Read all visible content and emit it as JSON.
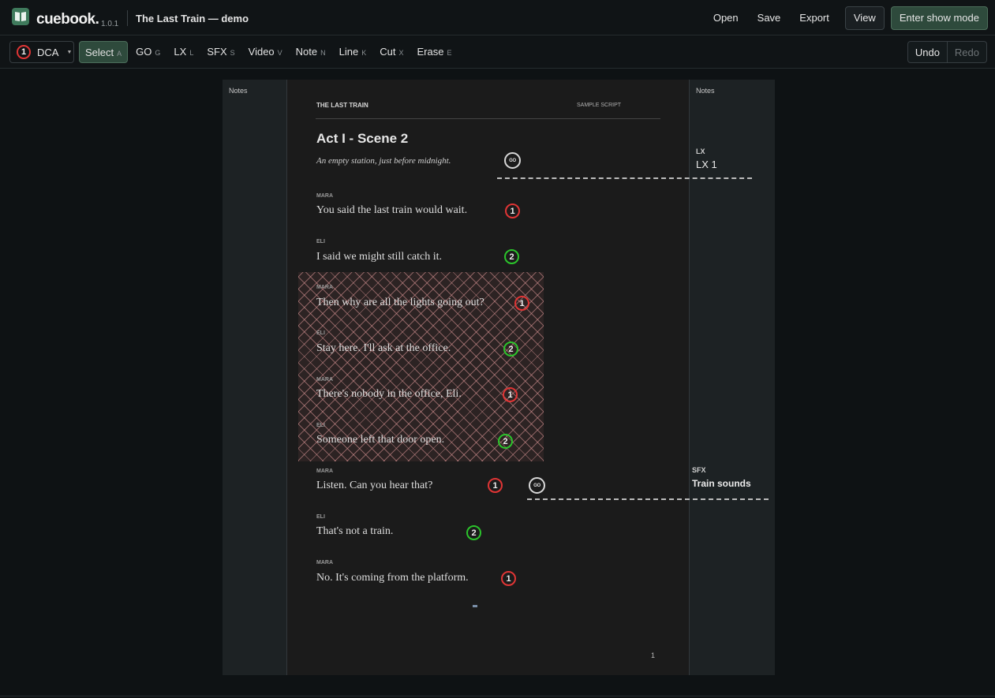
{
  "app": {
    "name": "cuebook.",
    "version": "1.0.1",
    "document_title": "The Last Train — demo"
  },
  "top_actions": {
    "open": "Open",
    "save": "Save",
    "export": "Export",
    "view": "View",
    "show_mode": "Enter show mode"
  },
  "toolbar": {
    "actor": {
      "number": "1",
      "label": "DCA",
      "color": "#e03535"
    },
    "tools": [
      {
        "label": "Select",
        "key": "A"
      },
      {
        "label": "GO",
        "key": "G"
      },
      {
        "label": "LX",
        "key": "L"
      },
      {
        "label": "SFX",
        "key": "S"
      },
      {
        "label": "Video",
        "key": "V"
      },
      {
        "label": "Note",
        "key": "N"
      },
      {
        "label": "Line",
        "key": "K"
      },
      {
        "label": "Cut",
        "key": "X"
      },
      {
        "label": "Erase",
        "key": "E"
      }
    ],
    "undo": "Undo",
    "redo": "Redo"
  },
  "page": {
    "notes_left": "Notes",
    "notes_right": "Notes",
    "header_title": "THE LAST TRAIN",
    "header_sub": "SAMPLE SCRIPT",
    "scene_title": "Act I - Scene 2",
    "scene_desc": "An empty station, just before midnight.",
    "go_marker": "GO",
    "lines": [
      {
        "speaker": "MARA",
        "text": "You said the last train would wait.",
        "cue": "1"
      },
      {
        "speaker": "ELI",
        "text": "I said we might still catch it.",
        "cue": "2"
      },
      {
        "speaker": "MARA",
        "text": "Then why are all the lights going out?",
        "cue": "1"
      },
      {
        "speaker": "ELI",
        "text": "Stay here. I'll ask at the office.",
        "cue": "2"
      },
      {
        "speaker": "MARA",
        "text": "There's nobody in the office, Eli.",
        "cue": "1"
      },
      {
        "speaker": "ELI",
        "text": "Someone left that door open.",
        "cue": "2"
      },
      {
        "speaker": "MARA",
        "text": "Listen. Can you hear that?",
        "cue": "1"
      },
      {
        "speaker": "ELI",
        "text": "That's not a train.",
        "cue": "2"
      },
      {
        "speaker": "MARA",
        "text": "No. It's coming from the platform.",
        "cue": "1"
      }
    ],
    "margin_cues": [
      {
        "type": "LX",
        "value": "LX 1"
      },
      {
        "type": "SFX",
        "value": "Train sounds"
      }
    ],
    "page_number": "1"
  },
  "colors": {
    "mara_cue": "#e03535",
    "eli_cue": "#2bc42b",
    "accent": "#2e4a3c"
  }
}
